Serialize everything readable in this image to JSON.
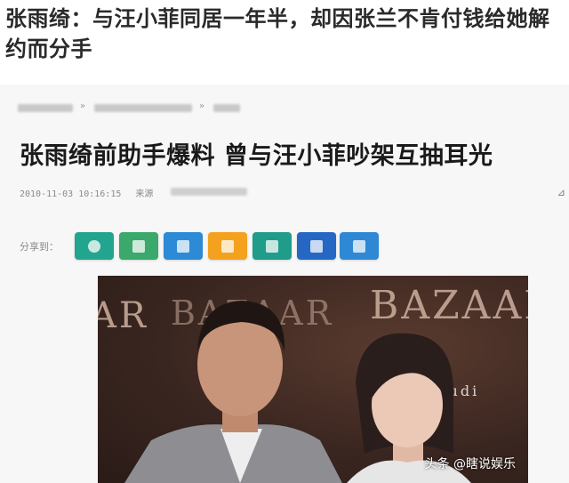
{
  "headline": {
    "line1": "张雨绮：与汪小菲同居一年半，却因张兰不肯付钱给她解",
    "line2": "约而分手"
  },
  "article": {
    "breadcrumb_sep_1": "»",
    "breadcrumb_sep_2": "»",
    "title": "张雨绮前助手爆料 曾与汪小菲吵架互抽耳光",
    "timestamp": "2010-11-03 10:16:15",
    "source_label": "来源",
    "share_label": "分享到："
  },
  "share_buttons": [
    {
      "icon": "share-icon-1",
      "color": "#22a58e"
    },
    {
      "icon": "share-icon-2",
      "color": "#3aa96b"
    },
    {
      "icon": "share-icon-3",
      "color": "#2c8ad6"
    },
    {
      "icon": "share-icon-4",
      "color": "#f4a21e"
    },
    {
      "icon": "share-icon-5",
      "color": "#1f9c8a"
    },
    {
      "icon": "share-icon-6",
      "color": "#2767c4"
    },
    {
      "icon": "share-icon-7",
      "color": "#2f88d4"
    }
  ],
  "photo": {
    "brand_text": "BAZAAR",
    "brand_fragment": "AR",
    "sponsor_text": "Audi"
  },
  "watermark": "头条 @瞎说娱乐"
}
